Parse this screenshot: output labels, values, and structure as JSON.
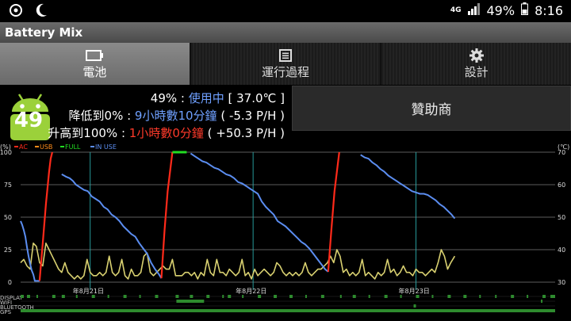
{
  "status_bar": {
    "icons_left": [
      "notification-icon",
      "moon-icon"
    ],
    "network_type": "4G",
    "battery": "49%",
    "time": "8:16"
  },
  "app": {
    "title": "Battery Mix"
  },
  "tabs": [
    {
      "label": "電池",
      "icon": "battery-icon",
      "active": true
    },
    {
      "label": "運行過程",
      "icon": "list-icon",
      "active": false
    },
    {
      "label": "設計",
      "icon": "gear-icon",
      "active": false
    }
  ],
  "battery_info": {
    "level": "49",
    "line1_prefix": "49% : ",
    "line1_status": "使用中",
    "line1_temp": " [ 37.0℃ ]",
    "line2_prefix": "降低到0% : ",
    "line2_time": "9小時數10分鐘",
    "line2_rate": " ( -5.3 P/H )",
    "line3_prefix": "升高到100% : ",
    "line3_time": "1小時數0分鐘",
    "line3_rate": " ( +50.3 P/H )"
  },
  "sponsor_button": {
    "label": "贊助商"
  },
  "colors": {
    "ac": "#ff2a1a",
    "usb": "#ff8c1a",
    "full": "#22dd22",
    "in_use": "#5b8df0",
    "temperature": "#d8d070",
    "event_bar": "#2e8b2e",
    "grid": "#7d7d7d",
    "day_marker": "#2aa8a8"
  },
  "chart_data": {
    "type": "line",
    "title": "",
    "y_left_unit": "(%)",
    "y_right_unit": "(℃)",
    "ylim": [
      0,
      100
    ],
    "y2lim": [
      30,
      70
    ],
    "yticks_left": [
      "100",
      "75",
      "50",
      "25",
      "0"
    ],
    "yticks_right": [
      "70",
      "60",
      "50",
      "40",
      "30"
    ],
    "legend": [
      "AC",
      "USB",
      "FULL",
      "IN USE"
    ],
    "day_labels": [
      "年8月21日",
      "年8月22日",
      "年8月23日"
    ],
    "event_rows": [
      "DISPLAY",
      "WIFI",
      "BLUETOOTH",
      "GPS"
    ],
    "series_in_use": [
      [
        0,
        47
      ],
      [
        2,
        44
      ],
      [
        4,
        40
      ],
      [
        6,
        35
      ],
      [
        8,
        27
      ],
      [
        10,
        20
      ],
      [
        12,
        14
      ],
      [
        14,
        9
      ],
      [
        16,
        6
      ],
      [
        18,
        1
      ],
      [
        20,
        1
      ],
      [
        22,
        1
      ],
      [
        24,
        1
      ],
      [
        52,
        83
      ],
      [
        55,
        82
      ],
      [
        58,
        81
      ],
      [
        62,
        80
      ],
      [
        66,
        78
      ],
      [
        70,
        75
      ],
      [
        75,
        73
      ],
      [
        80,
        71
      ],
      [
        85,
        70
      ],
      [
        90,
        66
      ],
      [
        95,
        64
      ],
      [
        100,
        62
      ],
      [
        105,
        58
      ],
      [
        110,
        56
      ],
      [
        115,
        52
      ],
      [
        120,
        50
      ],
      [
        125,
        47
      ],
      [
        130,
        43
      ],
      [
        135,
        40
      ],
      [
        140,
        37
      ],
      [
        145,
        35
      ],
      [
        150,
        30
      ],
      [
        155,
        26
      ],
      [
        160,
        22
      ],
      [
        165,
        15
      ],
      [
        170,
        10
      ],
      [
        175,
        6
      ],
      [
        178,
        3
      ],
      [
        215,
        99
      ],
      [
        220,
        97
      ],
      [
        225,
        95
      ],
      [
        230,
        93
      ],
      [
        235,
        92
      ],
      [
        240,
        90
      ],
      [
        245,
        88
      ],
      [
        250,
        87
      ],
      [
        255,
        85
      ],
      [
        260,
        83
      ],
      [
        265,
        82
      ],
      [
        270,
        80
      ],
      [
        275,
        77
      ],
      [
        280,
        76
      ],
      [
        285,
        74
      ],
      [
        290,
        72
      ],
      [
        295,
        70
      ],
      [
        300,
        68
      ],
      [
        305,
        62
      ],
      [
        310,
        58
      ],
      [
        315,
        55
      ],
      [
        320,
        52
      ],
      [
        325,
        47
      ],
      [
        330,
        45
      ],
      [
        335,
        43
      ],
      [
        340,
        40
      ],
      [
        345,
        37
      ],
      [
        350,
        34
      ],
      [
        355,
        31
      ],
      [
        360,
        29
      ],
      [
        365,
        26
      ],
      [
        370,
        22
      ],
      [
        375,
        18
      ],
      [
        380,
        14
      ],
      [
        385,
        10
      ],
      [
        389,
        8
      ],
      [
        430,
        98
      ],
      [
        435,
        96
      ],
      [
        440,
        95
      ],
      [
        445,
        92
      ],
      [
        450,
        90
      ],
      [
        455,
        87
      ],
      [
        460,
        85
      ],
      [
        465,
        82
      ],
      [
        470,
        80
      ],
      [
        475,
        78
      ],
      [
        480,
        76
      ],
      [
        485,
        74
      ],
      [
        490,
        72
      ],
      [
        495,
        70
      ],
      [
        500,
        69
      ],
      [
        505,
        68
      ],
      [
        510,
        68
      ],
      [
        515,
        67
      ],
      [
        520,
        65
      ],
      [
        525,
        63
      ],
      [
        530,
        60
      ],
      [
        535,
        58
      ],
      [
        540,
        55
      ],
      [
        545,
        52
      ],
      [
        549,
        49
      ]
    ],
    "series_ac": [
      [
        24,
        1
      ],
      [
        28,
        30
      ],
      [
        32,
        60
      ],
      [
        36,
        85
      ],
      [
        38,
        95
      ],
      [
        40,
        100
      ],
      [
        178,
        3
      ],
      [
        182,
        40
      ],
      [
        186,
        70
      ],
      [
        190,
        90
      ],
      [
        192,
        100
      ],
      [
        389,
        8
      ],
      [
        393,
        40
      ],
      [
        397,
        70
      ],
      [
        401,
        90
      ],
      [
        403,
        100
      ]
    ],
    "series_full": [
      [
        192,
        100
      ],
      [
        210,
        100
      ],
      [
        403,
        100
      ],
      [
        426,
        100
      ]
    ],
    "series_temperature": [
      [
        0,
        36
      ],
      [
        4,
        37
      ],
      [
        8,
        35
      ],
      [
        12,
        34
      ],
      [
        16,
        42
      ],
      [
        20,
        41
      ],
      [
        24,
        36
      ],
      [
        28,
        35
      ],
      [
        32,
        42
      ],
      [
        36,
        40
      ],
      [
        40,
        38
      ],
      [
        44,
        36
      ],
      [
        48,
        34
      ],
      [
        52,
        33
      ],
      [
        56,
        36
      ],
      [
        60,
        33
      ],
      [
        64,
        32
      ],
      [
        68,
        31
      ],
      [
        72,
        32
      ],
      [
        76,
        31
      ],
      [
        80,
        32
      ],
      [
        84,
        37
      ],
      [
        88,
        33
      ],
      [
        92,
        32
      ],
      [
        96,
        32
      ],
      [
        100,
        33
      ],
      [
        104,
        32
      ],
      [
        108,
        33
      ],
      [
        112,
        38
      ],
      [
        116,
        33
      ],
      [
        120,
        32
      ],
      [
        124,
        33
      ],
      [
        128,
        37
      ],
      [
        132,
        32
      ],
      [
        136,
        31
      ],
      [
        140,
        34
      ],
      [
        144,
        32
      ],
      [
        148,
        32
      ],
      [
        152,
        33
      ],
      [
        156,
        38
      ],
      [
        160,
        39
      ],
      [
        164,
        33
      ],
      [
        168,
        32
      ],
      [
        172,
        33
      ],
      [
        176,
        34
      ],
      [
        180,
        35
      ],
      [
        184,
        34
      ],
      [
        188,
        34
      ],
      [
        192,
        37
      ],
      [
        196,
        32
      ],
      [
        200,
        32
      ],
      [
        204,
        32
      ],
      [
        208,
        33
      ],
      [
        212,
        33
      ],
      [
        216,
        32
      ],
      [
        220,
        33
      ],
      [
        224,
        31
      ],
      [
        228,
        33
      ],
      [
        232,
        32
      ],
      [
        236,
        37
      ],
      [
        240,
        33
      ],
      [
        244,
        32
      ],
      [
        248,
        37
      ],
      [
        252,
        33
      ],
      [
        256,
        33
      ],
      [
        260,
        32
      ],
      [
        264,
        34
      ],
      [
        268,
        33
      ],
      [
        272,
        32
      ],
      [
        276,
        33
      ],
      [
        280,
        37
      ],
      [
        284,
        32
      ],
      [
        288,
        33
      ],
      [
        292,
        31
      ],
      [
        296,
        34
      ],
      [
        300,
        32
      ],
      [
        304,
        33
      ],
      [
        308,
        34
      ],
      [
        312,
        33
      ],
      [
        316,
        32
      ],
      [
        320,
        33
      ],
      [
        324,
        36
      ],
      [
        328,
        35
      ],
      [
        332,
        33
      ],
      [
        336,
        32
      ],
      [
        340,
        33
      ],
      [
        344,
        32
      ],
      [
        348,
        33
      ],
      [
        352,
        32
      ],
      [
        356,
        33
      ],
      [
        360,
        36
      ],
      [
        364,
        33
      ],
      [
        368,
        32
      ],
      [
        372,
        33
      ],
      [
        376,
        34
      ],
      [
        380,
        34
      ],
      [
        384,
        35
      ],
      [
        388,
        36
      ],
      [
        392,
        38
      ],
      [
        396,
        36
      ],
      [
        400,
        40
      ],
      [
        404,
        38
      ],
      [
        408,
        33
      ],
      [
        412,
        34
      ],
      [
        416,
        32
      ],
      [
        420,
        33
      ],
      [
        424,
        32
      ],
      [
        428,
        33
      ],
      [
        432,
        37
      ],
      [
        436,
        32
      ],
      [
        440,
        33
      ],
      [
        444,
        32
      ],
      [
        448,
        31
      ],
      [
        452,
        33
      ],
      [
        456,
        32
      ],
      [
        460,
        33
      ],
      [
        464,
        37
      ],
      [
        468,
        33
      ],
      [
        472,
        34
      ],
      [
        476,
        32
      ],
      [
        480,
        33
      ],
      [
        484,
        35
      ],
      [
        488,
        33
      ],
      [
        492,
        33
      ],
      [
        496,
        32
      ],
      [
        500,
        34
      ],
      [
        504,
        33
      ],
      [
        508,
        33
      ],
      [
        512,
        32
      ],
      [
        516,
        33
      ],
      [
        520,
        34
      ],
      [
        524,
        33
      ],
      [
        528,
        36
      ],
      [
        532,
        40
      ],
      [
        536,
        38
      ],
      [
        540,
        34
      ],
      [
        544,
        36
      ],
      [
        549,
        38
      ]
    ]
  }
}
